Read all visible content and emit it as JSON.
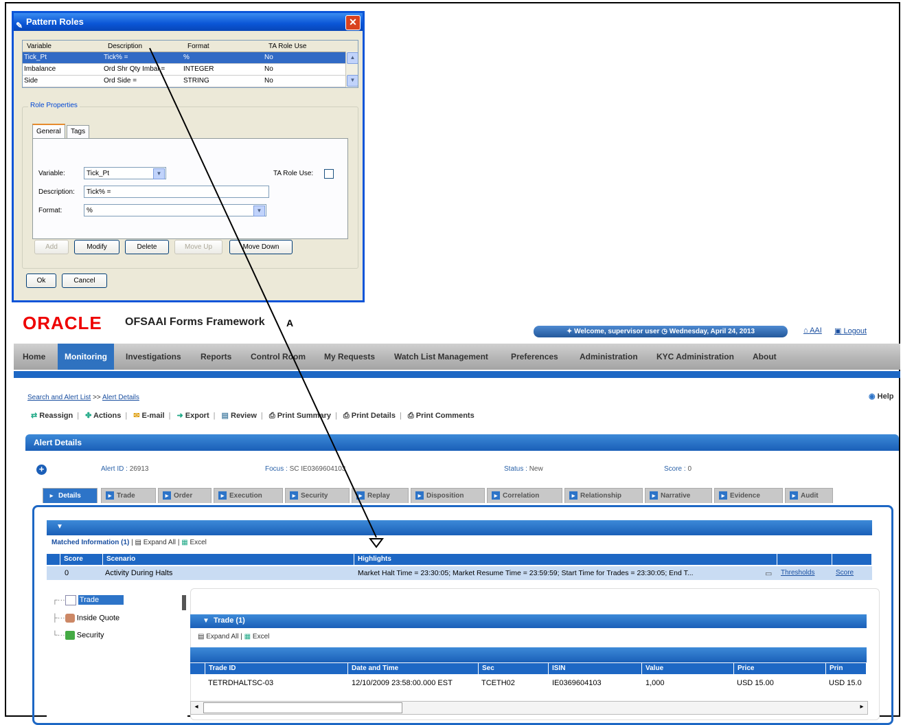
{
  "dialog": {
    "title": "Pattern Roles",
    "columns": [
      "Variable",
      "Description",
      "Format",
      "TA Role Use"
    ],
    "rows": [
      {
        "variable": "Tick_Pt",
        "description": "Tick% =",
        "format": "%",
        "ta": "No"
      },
      {
        "variable": "Imbalance",
        "description": "Ord Shr Qty Imbal =",
        "format": "INTEGER",
        "ta": "No"
      },
      {
        "variable": "Side",
        "description": "Ord Side =",
        "format": "STRING",
        "ta": "No"
      }
    ],
    "role_properties": "Role Properties",
    "tabs": [
      "General",
      "Tags"
    ],
    "variable_label": "Variable:",
    "variable_value": "Tick_Pt",
    "ta_role_label": "TA Role Use:",
    "description_label": "Description:",
    "description_value": "Tick% =",
    "format_label": "Format:",
    "format_value": "%",
    "buttons": {
      "add": "Add",
      "modify": "Modify",
      "delete": "Delete",
      "move_up": "Move Up",
      "move_down": "Move Down",
      "ok": "Ok",
      "cancel": "Cancel"
    }
  },
  "annotation": "A",
  "app": {
    "logo": "ORACLE",
    "title": "OFSAAI Forms Framework",
    "welcome": "Welcome, supervisor user",
    "date": "Wednesday, April 24, 2013",
    "aai": "AAI",
    "logout": "Logout",
    "help": "Help"
  },
  "nav": [
    "Home",
    "Monitoring",
    "Investigations",
    "Reports",
    "Control Room",
    "My Requests",
    "Watch List Management",
    "Preferences",
    "Administration",
    "KYC Administration",
    "About"
  ],
  "breadcrumb": {
    "first": "Search and Alert List",
    "sep": ">>",
    "second": "Alert Details"
  },
  "toolbar": [
    "Reassign",
    "Actions",
    "E-mail",
    "Export",
    "Review",
    "Print Summary",
    "Print Details",
    "Print Comments"
  ],
  "alert": {
    "panel_title": "Alert Details",
    "id_label": "Alert ID :",
    "id_value": "26913",
    "focus_label": "Focus :",
    "focus_value": "SC IE0369604103",
    "status_label": "Status :",
    "status_value": "New",
    "score_label": "Score :",
    "score_value": "0"
  },
  "detail_tabs": [
    "Details",
    "Trade",
    "Order",
    "Execution",
    "Security",
    "Replay",
    "Disposition",
    "Correlation",
    "Relationship",
    "Narrative",
    "Evidence",
    "Audit"
  ],
  "matched": {
    "title": "Matched Information",
    "count": "(1)",
    "expand_all": "Expand All",
    "excel": "Excel",
    "columns": [
      "Score",
      "Scenario",
      "Highlights"
    ],
    "row": {
      "score": "0",
      "scenario": "Activity During Halts",
      "highlights": "Market Halt Time = 23:30:05; Market Resume Time = 23:59:59; Start Time for Trades = 23:30:05; End T...",
      "thresholds": "Thresholds",
      "score_link": "Score"
    }
  },
  "tree": [
    "Trade",
    "Inside Quote",
    "Security"
  ],
  "trade": {
    "title": "Trade (1)",
    "expand_all": "Expand All",
    "excel": "Excel",
    "columns": [
      "Trade ID",
      "Date and Time",
      "Sec",
      "ISIN",
      "Value",
      "Price",
      "Prin"
    ],
    "row": [
      "TETRDHALTSC-03",
      "12/10/2009 23:58:00.000 EST",
      "TCETH02",
      "IE0369604103",
      "1,000",
      "USD 15.00",
      "USD 15.0"
    ]
  }
}
